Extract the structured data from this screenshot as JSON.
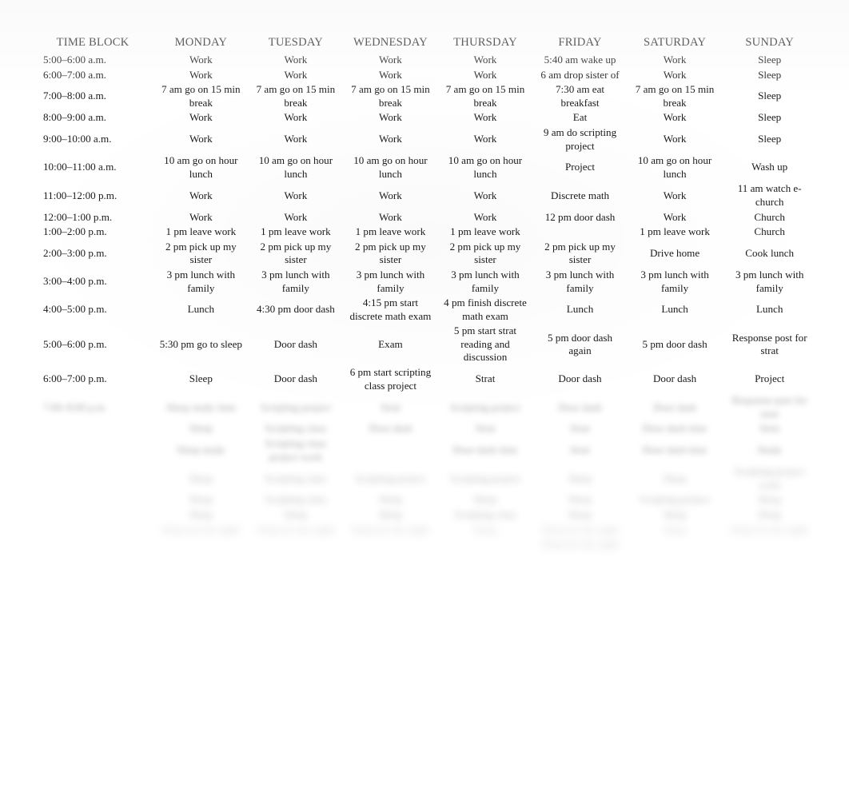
{
  "document": {
    "type": "weekly-schedule-table",
    "background_color": "#ffffff",
    "text_color": "#1a1a1a"
  },
  "table": {
    "headers": [
      "TIME BLOCK",
      "MONDAY",
      "TUESDAY",
      "WEDNESDAY",
      "THURSDAY",
      "FRIDAY",
      "SATURDAY",
      "SUNDAY"
    ],
    "rows": [
      {
        "time": "5:00–6:00 a.m.",
        "legible": true,
        "cells": [
          "Work",
          "Work",
          "Work",
          "Work",
          "5:40 am wake up",
          "Work",
          "Sleep"
        ]
      },
      {
        "time": "6:00–7:00 a.m.",
        "legible": true,
        "cells": [
          "Work",
          "Work",
          "Work",
          "Work",
          "6 am drop sister of",
          "Work",
          "Sleep"
        ]
      },
      {
        "time": "7:00–8:00 a.m.",
        "legible": true,
        "cells": [
          "7 am go on 15 min break",
          "7 am go on 15 min break",
          "7 am go on 15 min break",
          "7 am go on 15 min break",
          "7:30 am eat breakfast",
          "7 am go on 15 min break",
          "Sleep"
        ]
      },
      {
        "time": "8:00–9:00 a.m.",
        "legible": true,
        "cells": [
          "Work",
          "Work",
          "Work",
          "Work",
          "Eat",
          "Work",
          "Sleep"
        ]
      },
      {
        "time": "9:00–10:00 a.m.",
        "legible": true,
        "cells": [
          "Work",
          "Work",
          "Work",
          "Work",
          "9 am do scripting project",
          "Work",
          "Sleep"
        ]
      },
      {
        "time": "10:00–11:00 a.m.",
        "legible": true,
        "cells": [
          "10 am go on hour lunch",
          "10 am go on hour lunch",
          "10 am go on hour lunch",
          "10 am go on hour lunch",
          "Project",
          "10 am go on hour lunch",
          "Wash up"
        ]
      },
      {
        "time": "11:00–12:00 p.m.",
        "legible": true,
        "cells": [
          "Work",
          "Work",
          "Work",
          "Work",
          "Discrete math",
          "Work",
          "11 am watch e-church"
        ]
      },
      {
        "time": "12:00–1:00 p.m.",
        "legible": true,
        "cells": [
          "Work",
          "Work",
          "Work",
          "Work",
          "12 pm door dash",
          "Work",
          "Church"
        ]
      },
      {
        "time": "1:00–2:00 p.m.",
        "legible": true,
        "cells": [
          "1 pm leave work",
          "1 pm leave work",
          "1 pm leave work",
          "1 pm leave work",
          "",
          "1 pm leave work",
          "Church"
        ]
      },
      {
        "time": "2:00–3:00 p.m.",
        "legible": true,
        "cells": [
          "2 pm pick up my sister",
          "2 pm pick up my sister",
          "2 pm pick up my sister",
          "2 pm pick up my sister",
          "2 pm pick up my sister",
          "Drive home",
          "Cook lunch"
        ]
      },
      {
        "time": "3:00–4:00 p.m.",
        "legible": true,
        "cells": [
          "3 pm lunch with family",
          "3 pm lunch with family",
          "3 pm lunch with family",
          "3 pm lunch with family",
          "3 pm lunch with family",
          "3 pm lunch with family",
          "3 pm lunch with family"
        ]
      },
      {
        "time": "4:00–5:00 p.m.",
        "legible": true,
        "cells": [
          "Lunch",
          "4:30 pm door dash",
          "4:15 pm start discrete math exam",
          "4 pm finish discrete math exam",
          "Lunch",
          "Lunch",
          "Lunch"
        ]
      },
      {
        "time": "5:00–6:00 p.m.",
        "legible": true,
        "cells": [
          "5:30 pm go to sleep",
          "Door dash",
          "Exam",
          "5 pm start strat reading and discussion",
          "5 pm door dash again",
          "5 pm door dash",
          "Response post for strat"
        ]
      },
      {
        "time": "6:00–7:00 p.m.",
        "legible": true,
        "cells": [
          "Sleep",
          "Door dash",
          "6 pm start scripting class project",
          "Strat",
          "Door dash",
          "Door dash",
          "Project"
        ]
      },
      {
        "time": "7:00–8:00 p.m.",
        "legible": true,
        "blur": "blurred",
        "cells": [
          "Sleep study time",
          "Scripting project",
          "Strat",
          "Scripting project",
          "Door dash",
          "Door dash",
          "Response post for strat"
        ]
      },
      {
        "time": "",
        "legible": false,
        "blur": "blurred",
        "cells": [
          "Sleep",
          "Scripting class",
          "Door dash",
          "Strat",
          "Strat",
          "Door dash time",
          "Strat"
        ]
      },
      {
        "time": "",
        "legible": false,
        "blur": "blurred",
        "cells": [
          "Sleep study",
          "Scripting class project work",
          "",
          "Door dash time",
          "Strat",
          "Door dash time",
          "Study"
        ]
      },
      {
        "time": "",
        "legible": false,
        "blur": "blurred-strong",
        "cells": [
          "Sleep",
          "Scripting class",
          "Scripting project",
          "Scripting project",
          "Sleep",
          "Sleep",
          "Scripting project work"
        ]
      },
      {
        "time": "",
        "legible": false,
        "blur": "blurred-strong",
        "cells": [
          "Sleep",
          "Scripting class",
          "Sleep",
          "Sleep",
          "Sleep",
          "Scripting project",
          "Sleep"
        ]
      },
      {
        "time": "",
        "legible": false,
        "blur": "blurred-strong",
        "cells": [
          "Sleep",
          "Sleep",
          "Sleep",
          "Scripting class",
          "Sleep",
          "Sleep",
          "Sleep"
        ]
      },
      {
        "time": "",
        "legible": false,
        "blur": "blurred-faint",
        "cells": [
          "Sleep for the night",
          "Sleep for the night",
          "Sleep for the night",
          "Sleep",
          "Sleep for the night",
          "Sleep",
          "Sleep for the night"
        ]
      },
      {
        "time": "",
        "legible": false,
        "blur": "blurred-faint",
        "cells": [
          "",
          "",
          "",
          "",
          "Sleep for the night",
          "",
          ""
        ]
      }
    ]
  }
}
